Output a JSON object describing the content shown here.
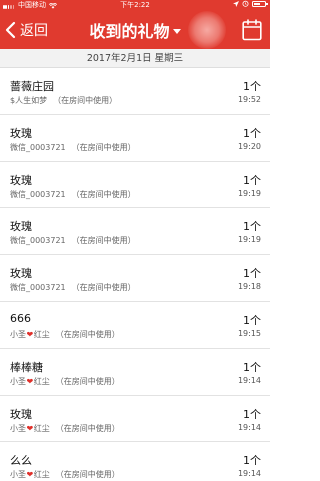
{
  "status_bar": {
    "carrier": "中国移动",
    "time": "下午2:22"
  },
  "nav": {
    "back_label": "返回",
    "title": "收到的礼物"
  },
  "date_header": "2017年2月1日 星期三",
  "colors": {
    "brand_red": "#e03a2f",
    "heart_red": "#e0302a"
  },
  "gifts": [
    {
      "name": "蔷薇庄园",
      "sender_prefix": "$人生如梦",
      "heart": false,
      "sender_suffix": "",
      "note": "（在房间中使用）",
      "count": "1个",
      "time": "19:52"
    },
    {
      "name": "玫瑰",
      "sender_prefix": "微信_0003721",
      "heart": false,
      "sender_suffix": "",
      "note": "（在房间中使用）",
      "count": "1个",
      "time": "19:20"
    },
    {
      "name": "玫瑰",
      "sender_prefix": "微信_0003721",
      "heart": false,
      "sender_suffix": "",
      "note": "（在房间中使用）",
      "count": "1个",
      "time": "19:19"
    },
    {
      "name": "玫瑰",
      "sender_prefix": "微信_0003721",
      "heart": false,
      "sender_suffix": "",
      "note": "（在房间中使用）",
      "count": "1个",
      "time": "19:19"
    },
    {
      "name": "玫瑰",
      "sender_prefix": "微信_0003721",
      "heart": false,
      "sender_suffix": "",
      "note": "（在房间中使用）",
      "count": "1个",
      "time": "19:18"
    },
    {
      "name": "666",
      "sender_prefix": "小圣",
      "heart": true,
      "sender_suffix": "红尘",
      "note": "（在房间中使用）",
      "count": "1个",
      "time": "19:15"
    },
    {
      "name": "棒棒糖",
      "sender_prefix": "小圣",
      "heart": true,
      "sender_suffix": "红尘",
      "note": "（在房间中使用）",
      "count": "1个",
      "time": "19:14"
    },
    {
      "name": "玫瑰",
      "sender_prefix": "小圣",
      "heart": true,
      "sender_suffix": "红尘",
      "note": "（在房间中使用）",
      "count": "1个",
      "time": "19:14"
    },
    {
      "name": "么么",
      "sender_prefix": "小圣",
      "heart": true,
      "sender_suffix": "红尘",
      "note": "（在房间中使用）",
      "count": "1个",
      "time": "19:14"
    }
  ]
}
